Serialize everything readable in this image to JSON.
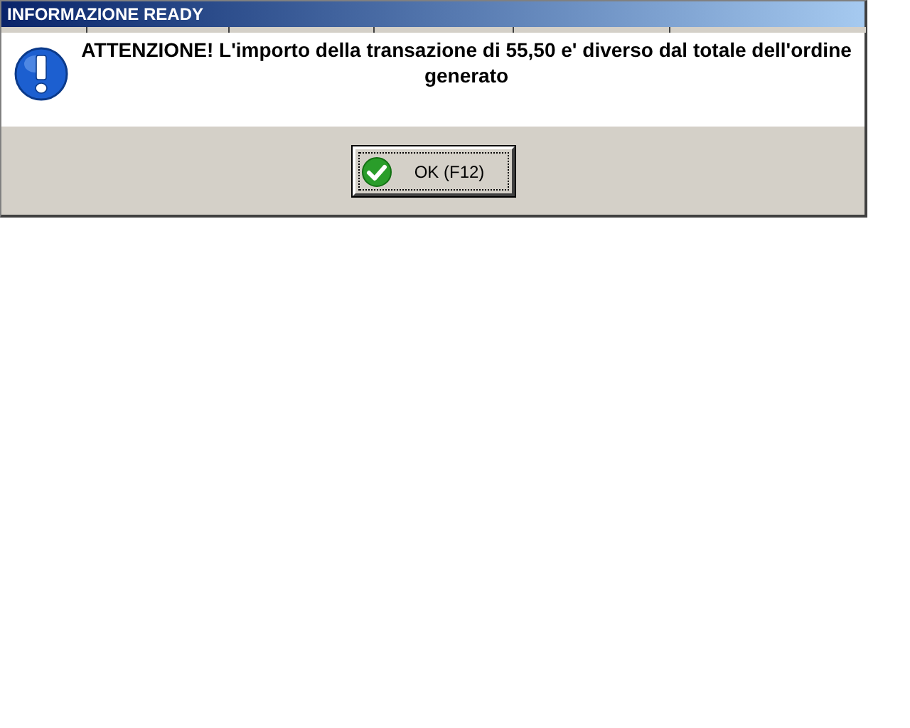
{
  "window": {
    "title": "INFORMAZIONE READY"
  },
  "message": "ATTENZIONE! L'importo della transazione di 55,50 e' diverso dal totale dell'ordine generato",
  "buttons": [
    {
      "label": "OK (F12)",
      "focused": true
    }
  ]
}
